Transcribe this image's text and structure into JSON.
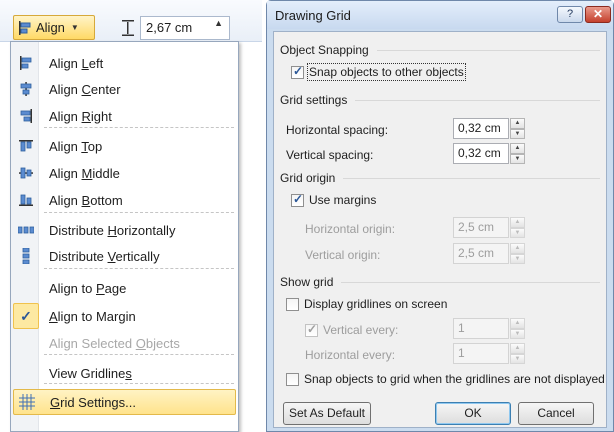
{
  "ribbon": {
    "align_button_label": "Align",
    "size_value": "2,67 cm"
  },
  "align_menu": {
    "items": [
      {
        "pre": "Align ",
        "acc": "L",
        "post": "eft",
        "icon": "align-left-icon",
        "state": "normal"
      },
      {
        "pre": "Align ",
        "acc": "C",
        "post": "enter",
        "icon": "align-center-icon",
        "state": "normal"
      },
      {
        "pre": "Align ",
        "acc": "R",
        "post": "ight",
        "icon": "align-right-icon",
        "state": "normal"
      },
      {
        "pre": "Align ",
        "acc": "T",
        "post": "op",
        "icon": "align-top-icon",
        "state": "normal"
      },
      {
        "pre": "Align ",
        "acc": "M",
        "post": "iddle",
        "icon": "align-middle-icon",
        "state": "normal"
      },
      {
        "pre": "Align ",
        "acc": "B",
        "post": "ottom",
        "icon": "align-bottom-icon",
        "state": "normal"
      },
      {
        "pre": "Distribute ",
        "acc": "H",
        "post": "orizontally",
        "icon": "distribute-horizontally-icon",
        "state": "normal"
      },
      {
        "pre": "Distribute ",
        "acc": "V",
        "post": "ertically",
        "icon": "distribute-vertically-icon",
        "state": "normal"
      },
      {
        "pre": "Align to ",
        "acc": "P",
        "post": "age",
        "icon": "",
        "state": "normal"
      },
      {
        "pre": "",
        "acc": "A",
        "post": "lign to Margin",
        "icon": "checkmark-icon",
        "state": "checked"
      },
      {
        "pre": "Align Selected ",
        "acc": "O",
        "post": "bjects",
        "icon": "",
        "state": "disabled"
      },
      {
        "pre": "View Gridline",
        "acc": "s",
        "post": "",
        "icon": "",
        "state": "normal"
      },
      {
        "pre": "",
        "acc": "G",
        "post": "rid Settings...",
        "icon": "grid-icon",
        "state": "hover"
      }
    ]
  },
  "dialog": {
    "title": "Drawing Grid",
    "help_label": "?",
    "close_label": "✕",
    "object_snapping": {
      "heading": "Object Snapping",
      "snap_to_objects_label": "Snap objects to other objects",
      "snap_to_objects_checked": true
    },
    "grid_settings": {
      "heading": "Grid settings",
      "horizontal_spacing_label": "Horizontal spacing:",
      "horizontal_spacing_value": "0,32 cm",
      "vertical_spacing_label": "Vertical spacing:",
      "vertical_spacing_value": "0,32 cm"
    },
    "grid_origin": {
      "heading": "Grid origin",
      "use_margins_label": "Use margins",
      "use_margins_checked": true,
      "horizontal_origin_label": "Horizontal origin:",
      "horizontal_origin_value": "2,5 cm",
      "vertical_origin_label": "Vertical origin:",
      "vertical_origin_value": "2,5 cm"
    },
    "show_grid": {
      "heading": "Show grid",
      "display_gridlines_label": "Display gridlines on screen",
      "display_gridlines_checked": false,
      "vertical_every_label": "Vertical every:",
      "vertical_every_checked": true,
      "vertical_every_value": "1",
      "horizontal_every_label": "Horizontal every:",
      "horizontal_every_value": "1",
      "snap_to_grid_label": "Snap objects to grid when the gridlines are not displayed",
      "snap_to_grid_checked": false
    },
    "buttons": {
      "set_default": "Set As Default",
      "ok": "OK",
      "cancel": "Cancel"
    }
  }
}
